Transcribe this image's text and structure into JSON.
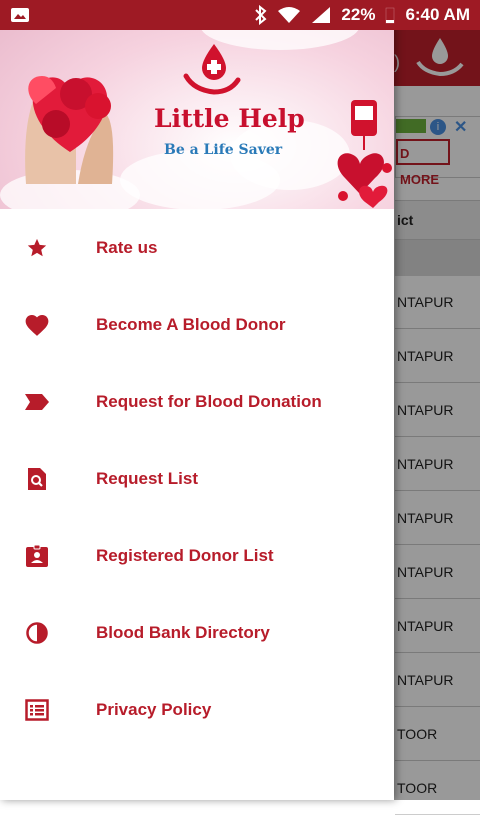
{
  "status_bar": {
    "battery": "22%",
    "time": "6:40 AM"
  },
  "drawer": {
    "banner": {
      "title": "Little Help",
      "tagline": "Be a Life Saver"
    },
    "items": [
      {
        "label": "Rate us",
        "icon": "star-icon"
      },
      {
        "label": "Become A Blood Donor",
        "icon": "heart-icon"
      },
      {
        "label": "Request for Blood Donation",
        "icon": "label-tag-icon"
      },
      {
        "label": "Request List",
        "icon": "find-in-page-icon"
      },
      {
        "label": "Registered Donor List",
        "icon": "id-badge-icon"
      },
      {
        "label": "Blood Bank Directory",
        "icon": "tonality-icon"
      },
      {
        "label": "Privacy Policy",
        "icon": "list-document-icon"
      }
    ]
  },
  "background": {
    "ad_button": "D MORE",
    "table_header": "ict",
    "rows": [
      "NTAPUR",
      "NTAPUR",
      "NTAPUR",
      "NTAPUR",
      "NTAPUR",
      "NTAPUR",
      "NTAPUR",
      "NTAPUR",
      "TOOR",
      "TOOR"
    ]
  },
  "colors": {
    "accent": "#c0212c",
    "status_bar": "#9e1a24",
    "menu_text": "#b71c2a"
  }
}
